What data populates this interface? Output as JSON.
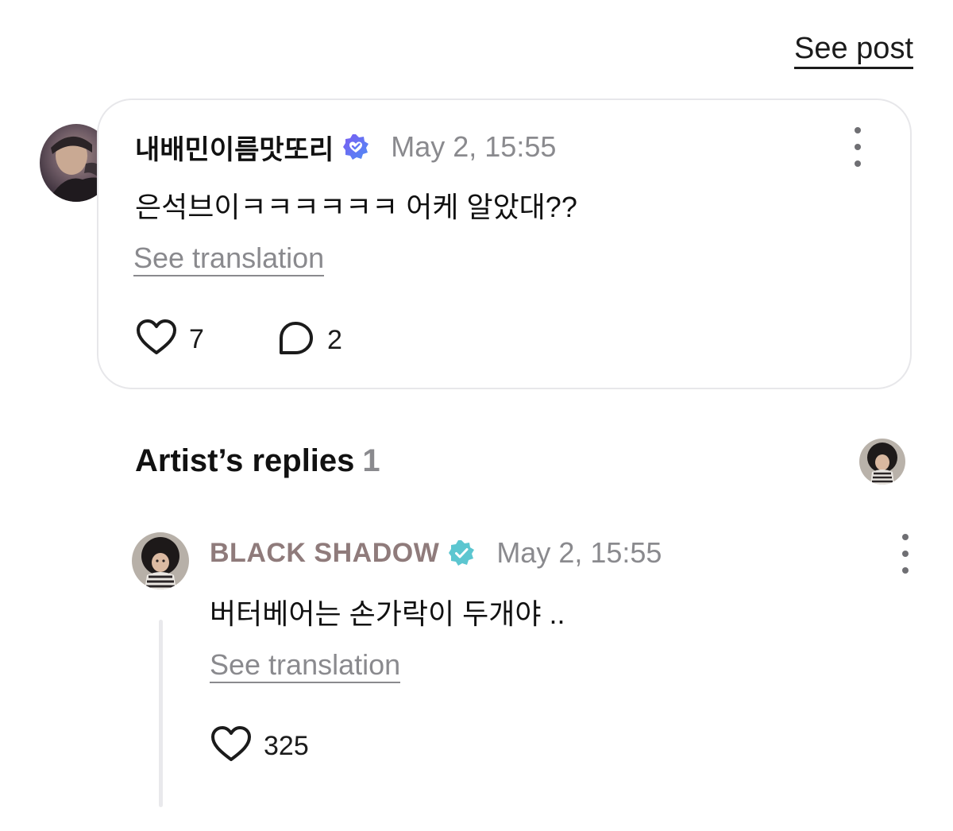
{
  "header": {
    "see_post_label": "See post"
  },
  "comment": {
    "username": "내배민이름맛또리",
    "timestamp": "May 2, 15:55",
    "text": "은석브이ㅋㅋㅋㅋㅋㅋ 어케 알았대??",
    "translate_label": "See translation",
    "likes": "7",
    "replies": "2"
  },
  "artist_section": {
    "title": "Artist’s replies",
    "count": "1"
  },
  "reply": {
    "username": "BLACK SHADOW",
    "timestamp": "May 2, 15:55",
    "text": "버터베어는 손가락이 두개야 ..",
    "translate_label": "See translation",
    "likes": "325"
  },
  "colors": {
    "fan_badge": "#6f5cf1",
    "artist_badge": "#5cc6d0",
    "muted_text": "#8a8a8e",
    "artist_name": "#8f7b7b"
  },
  "icons": [
    "verified-fan-icon",
    "verified-artist-icon",
    "heart-icon",
    "comment-bubble-icon",
    "more-options-icon"
  ]
}
